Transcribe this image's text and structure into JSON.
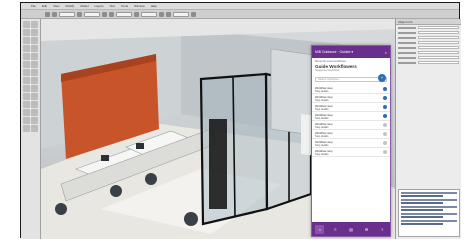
{
  "menubar": {
    "items": [
      "File",
      "Edit",
      "View",
      "Modify",
      "Model",
      "Layers",
      "Text",
      "Tools",
      "Window",
      "Help"
    ]
  },
  "assistant": {
    "header": "MIB Guidance · Guided ▾",
    "close_glyph": "×",
    "sub": "Recently used workflows",
    "title": "Guide Workflowers",
    "subtitle": "Suggested workflows",
    "badge": "+",
    "search_placeholder": "Search workflows...",
    "steps": [
      {
        "label": "Workflow step",
        "detail": "Step details"
      },
      {
        "label": "Workflow step",
        "detail": "Step details"
      },
      {
        "label": "Workflow step",
        "detail": "Step details"
      },
      {
        "label": "Workflow step",
        "detail": "Step details"
      },
      {
        "label": "Workflow step",
        "detail": "Step details"
      },
      {
        "label": "Workflow step",
        "detail": "Step details"
      },
      {
        "label": "Workflow step",
        "detail": "Step details"
      },
      {
        "label": "Workflow step",
        "detail": "Step details"
      }
    ],
    "footer_icons": [
      "home-icon",
      "list-icon",
      "book-icon",
      "gear-icon",
      "help-icon"
    ]
  },
  "oip": {
    "header": "Object Info"
  },
  "colors": {
    "accent": "#6a2f8c",
    "accent_light": "#8a52ad",
    "link_blue": "#2b6fb6",
    "glass_frame": "#111111",
    "orange_wall": "#c8542a"
  }
}
